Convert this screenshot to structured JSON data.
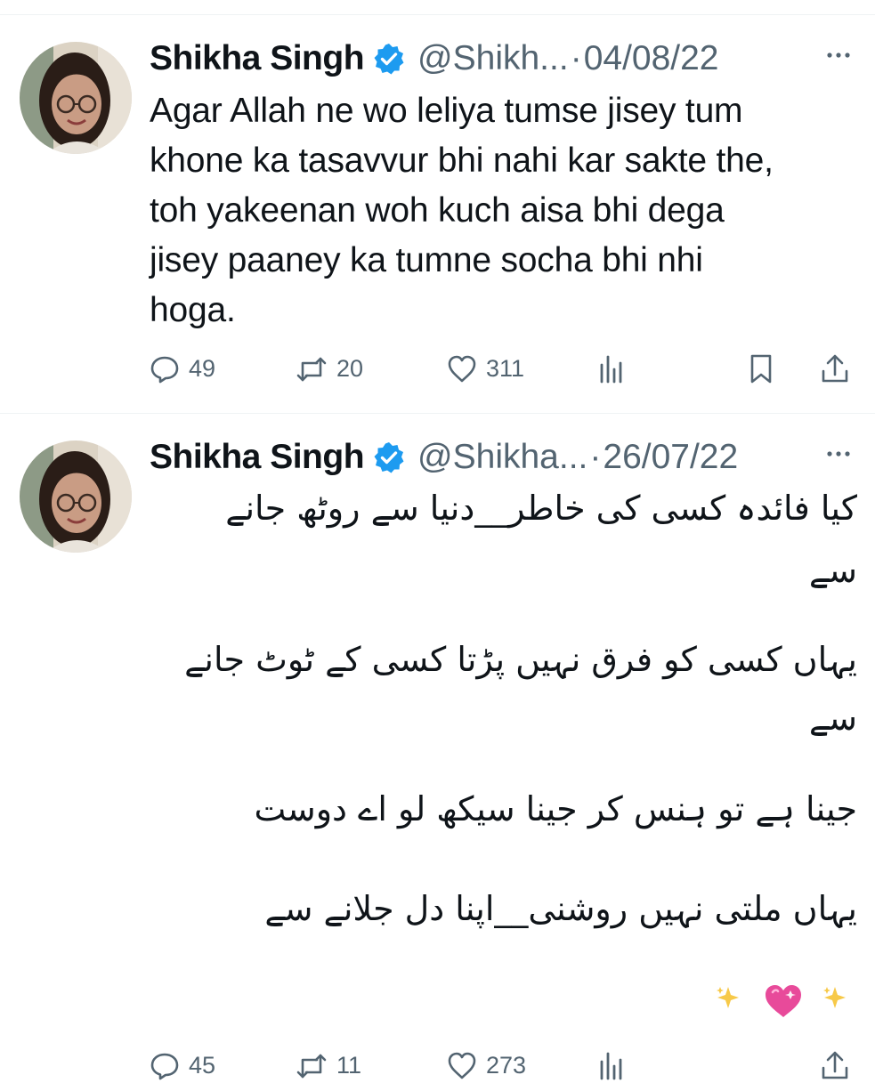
{
  "tweets": [
    {
      "author": {
        "name": "Shikha Singh",
        "handle": "@Shikh...",
        "verified": true,
        "avatar": "profile-photo"
      },
      "separator": "·",
      "date": "04/08/22",
      "text_lines": [
        "Agar Allah ne wo leliya tumse jisey tum",
        "khone ka tasavvur bhi nahi kar sakte the,",
        "toh yakeenan woh kuch aisa bhi dega",
        "jisey paaney ka tumne socha bhi nhi",
        "hoga."
      ],
      "stats": {
        "replies": "49",
        "retweets": "20",
        "likes": "311"
      }
    },
    {
      "author": {
        "name": "Shikha Singh",
        "handle": "@Shikha...",
        "verified": true,
        "avatar": "profile-photo"
      },
      "separator": "·",
      "date": "26/07/22",
      "text_lines": [
        "کیا فائدہ کسی کی خاطر__دنیا سے روٹھ جانے",
        "سے",
        "یہاں کسی کو فرق نہیں پڑتا کسی کے ٹوٹ جانے",
        "سے",
        "جینا ہے تو ہنس کر جینا سیکھ لو اے دوست",
        "یہاں ملتی نہیں روشنی__اپنا دل جلانے سے"
      ],
      "emojis": [
        "✨",
        "💖",
        "✨"
      ],
      "stats": {
        "replies": "45",
        "retweets": "11",
        "likes": "273"
      }
    }
  ],
  "icons": {
    "reply": "speech-bubble-icon",
    "retweet": "retweet-arrows-icon",
    "like": "heart-icon",
    "views": "bar-chart-icon",
    "bookmark": "bookmark-icon",
    "share": "share-upload-icon",
    "more": "ellipsis-icon",
    "verified": "verified-badge-icon"
  },
  "colors": {
    "text": "#0f1419",
    "secondary": "#536471",
    "verified": "#1d9bf0",
    "divider": "#eff3f4"
  }
}
